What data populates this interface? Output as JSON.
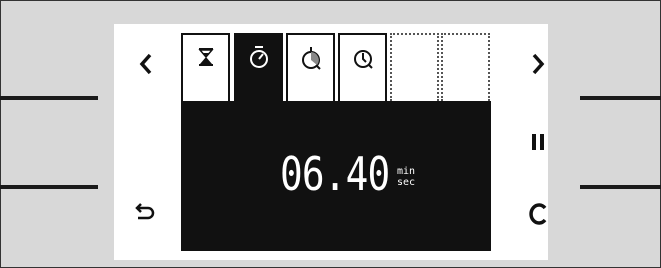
{
  "display": {
    "time_value": "06.40",
    "unit_top": "min",
    "unit_bottom": "sec"
  },
  "tabs": [
    {
      "icon": "hourglass-icon",
      "state": "normal"
    },
    {
      "icon": "timer-icon",
      "state": "active"
    },
    {
      "icon": "duration-pie-icon",
      "state": "normal"
    },
    {
      "icon": "clock-icon",
      "state": "normal"
    },
    {
      "icon": "",
      "state": "empty"
    },
    {
      "icon": "",
      "state": "empty"
    }
  ],
  "controls": {
    "left": [
      "back-chevron-icon",
      "return-icon"
    ],
    "right": [
      "forward-chevron-icon",
      "pause-icon",
      "clear-icon"
    ]
  }
}
